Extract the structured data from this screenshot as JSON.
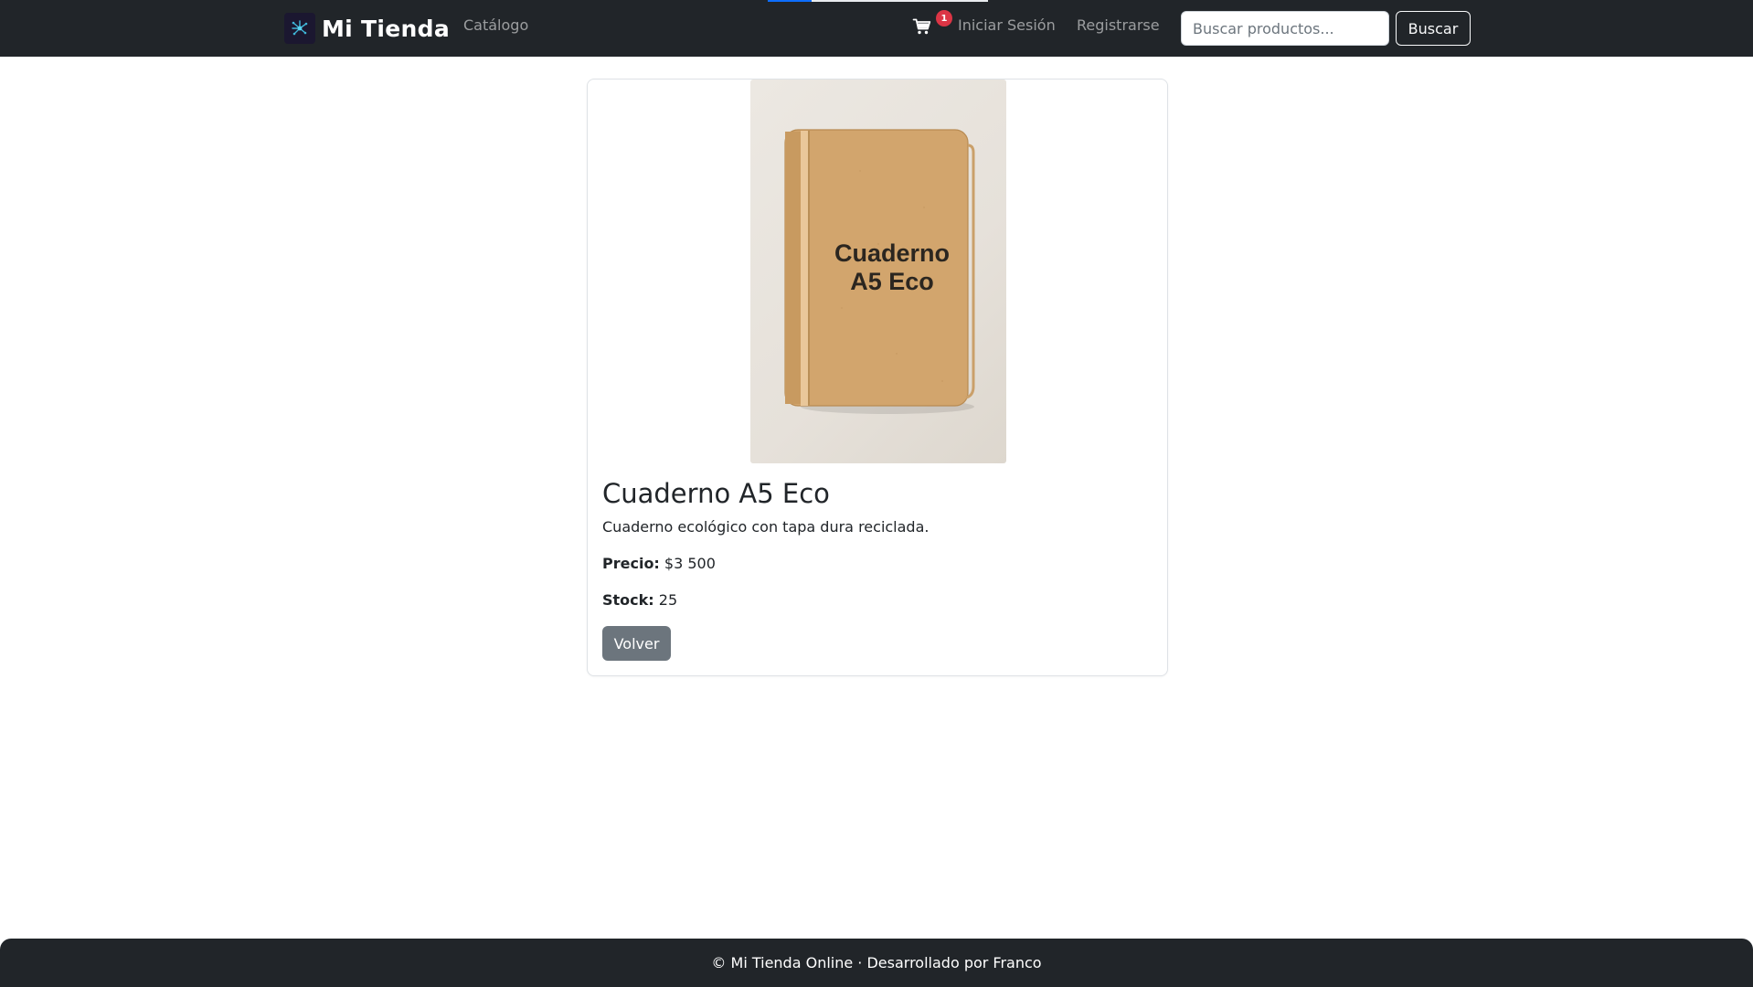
{
  "header": {
    "brand": "Mi Tienda",
    "nav": {
      "catalog": "Catálogo",
      "login": "Iniciar Sesión",
      "register": "Registrarse"
    },
    "cart": {
      "count": "1"
    },
    "search": {
      "placeholder": "Buscar productos...",
      "value": "",
      "button": "Buscar"
    }
  },
  "product": {
    "image_text": "Cuaderno A5 Eco",
    "title": "Cuaderno A5 Eco",
    "description": "Cuaderno ecológico con tapa dura reciclada.",
    "price_label": "Precio:",
    "price_value": "$3 500",
    "stock_label": "Stock:",
    "stock_value": "25",
    "back_button": "Volver"
  },
  "footer": {
    "text": "© Mi Tienda Online · Desarrollado por Franco"
  },
  "icons": {
    "brand_logo": "network-logo-icon",
    "cart": "shopping-cart-icon"
  },
  "colors": {
    "navbar": "#212529",
    "badge": "#dc3545",
    "secondary_button": "#6c757d",
    "accent": "#0d6efd"
  }
}
